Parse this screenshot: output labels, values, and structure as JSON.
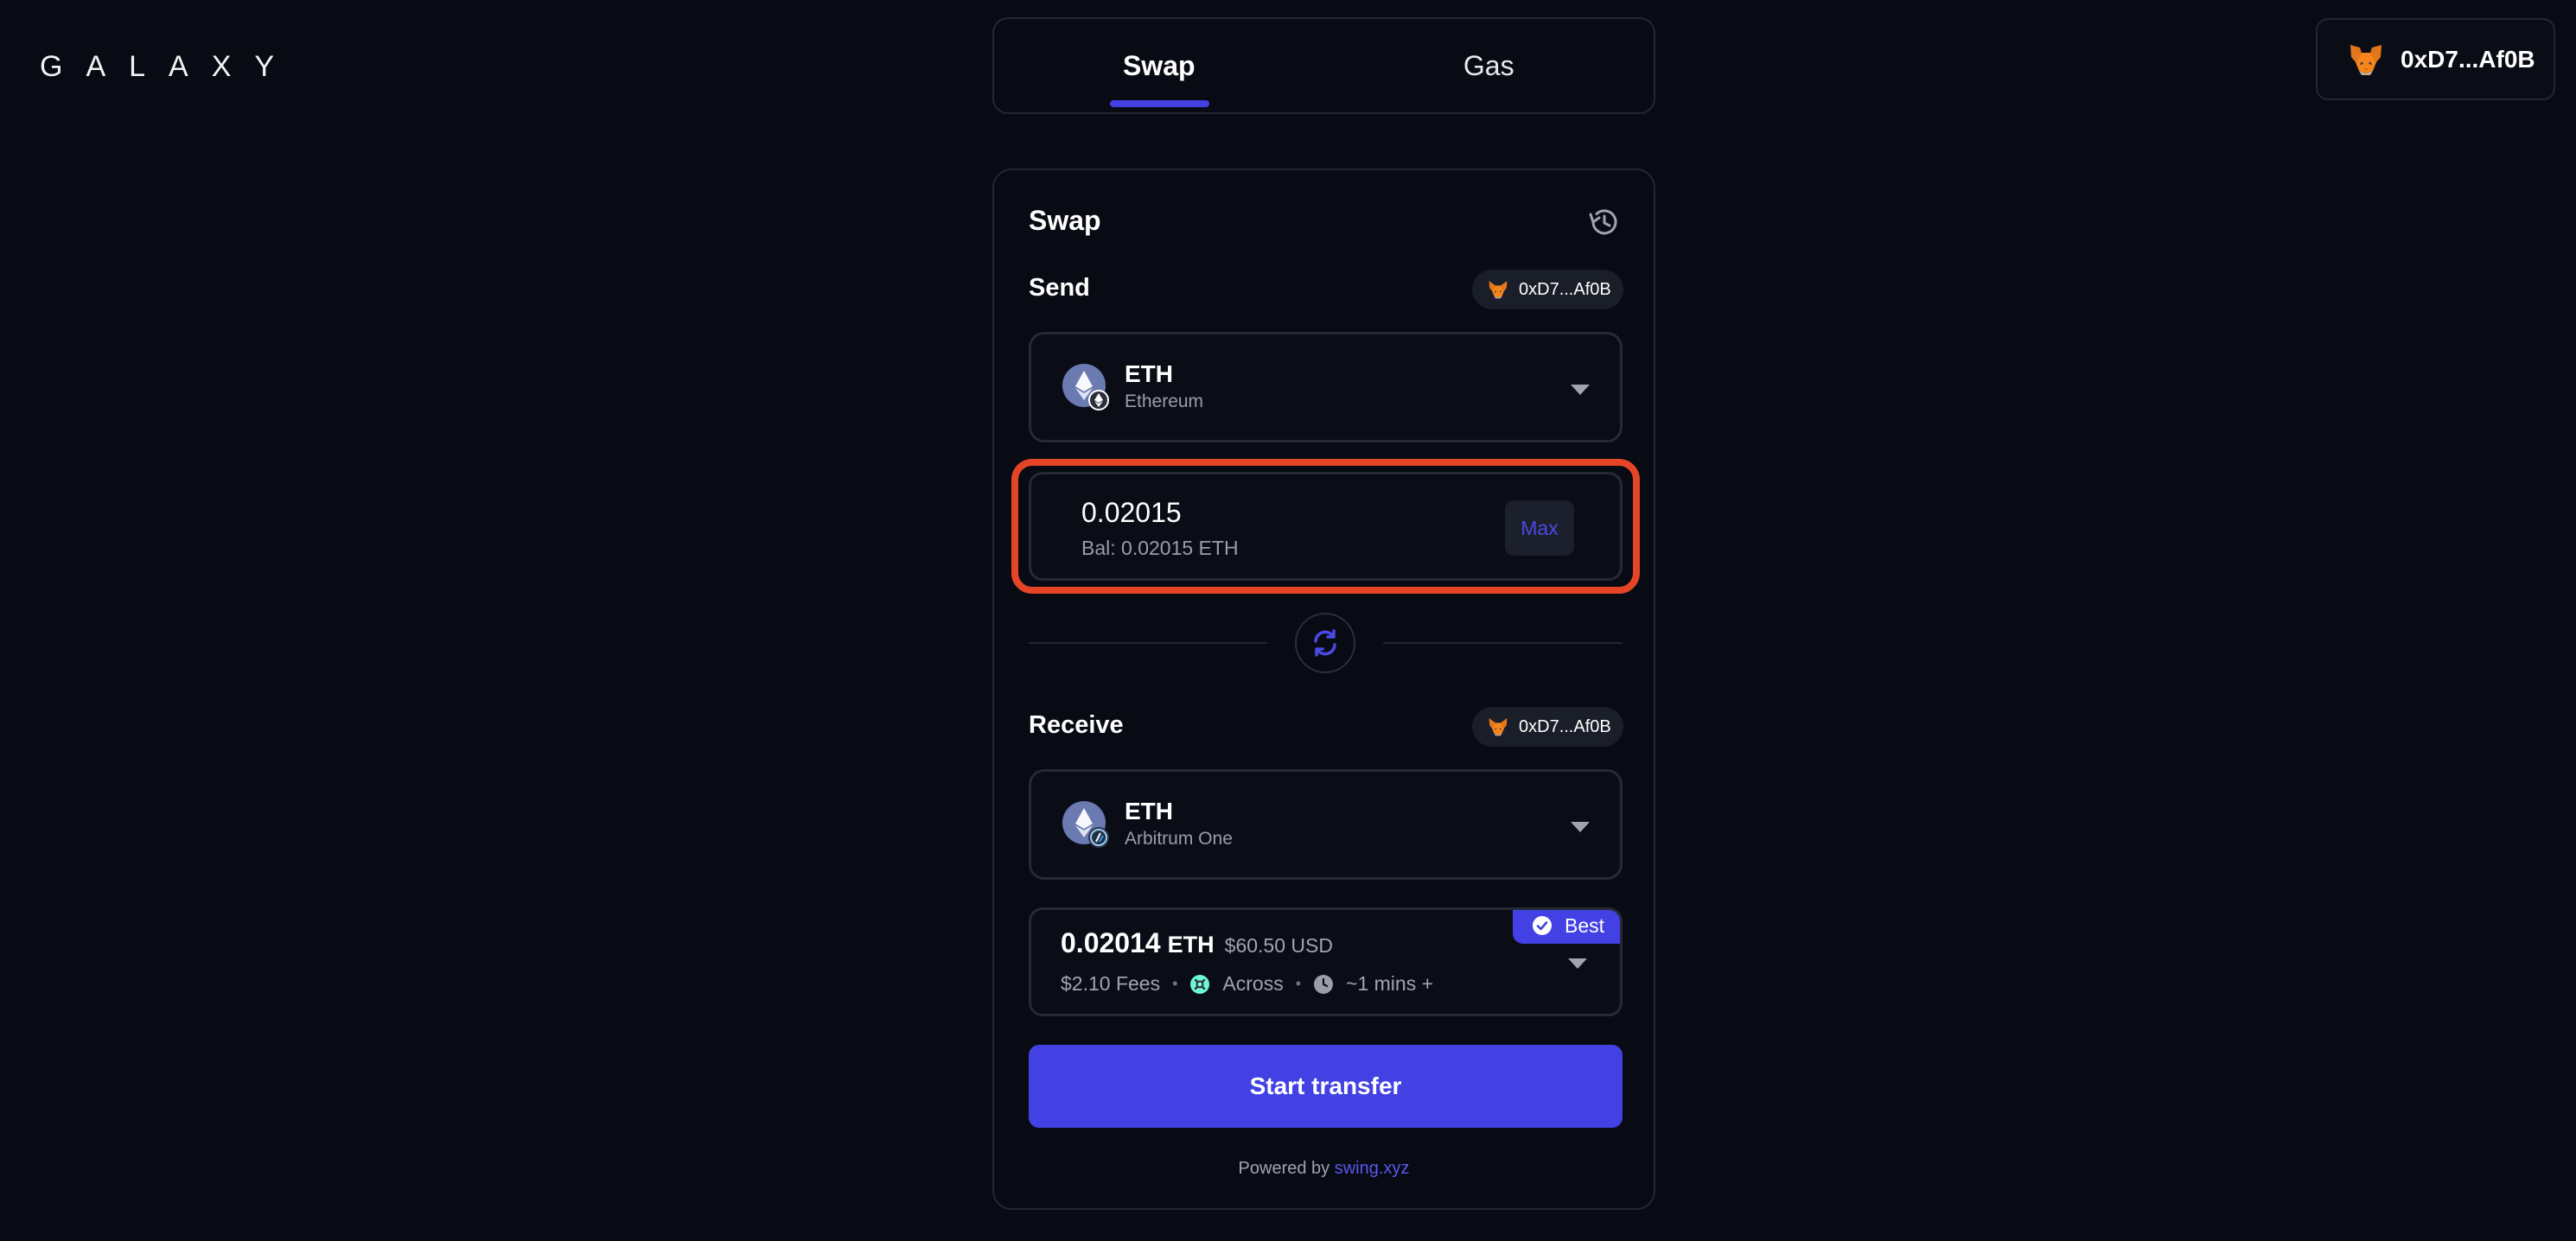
{
  "brand": {
    "logo_text": "GALAXY"
  },
  "wallet": {
    "address_short": "0xD7...Af0B"
  },
  "tabs": [
    {
      "label": "Swap",
      "active": true
    },
    {
      "label": "Gas",
      "active": false
    }
  ],
  "swap": {
    "title": "Swap",
    "send": {
      "label": "Send",
      "address": "0xD7...Af0B",
      "token": "ETH",
      "chain": "Ethereum",
      "amount": "0.02015",
      "balance": "Bal: 0.02015 ETH",
      "max_label": "Max"
    },
    "receive": {
      "label": "Receive",
      "address": "0xD7...Af0B",
      "token": "ETH",
      "chain": "Arbitrum One"
    },
    "quote": {
      "badge": "Best",
      "amount": "0.02014",
      "unit": "ETH",
      "usd": "$60.50 USD",
      "fees": "$2.10 Fees",
      "bridge": "Across",
      "time": "~1 mins +"
    },
    "start_label": "Start transfer",
    "powered_prefix": "Powered by",
    "powered_link": "swing.xyz"
  },
  "colors": {
    "accent": "#4341e3",
    "highlight": "#e64426",
    "background": "#080b13"
  }
}
